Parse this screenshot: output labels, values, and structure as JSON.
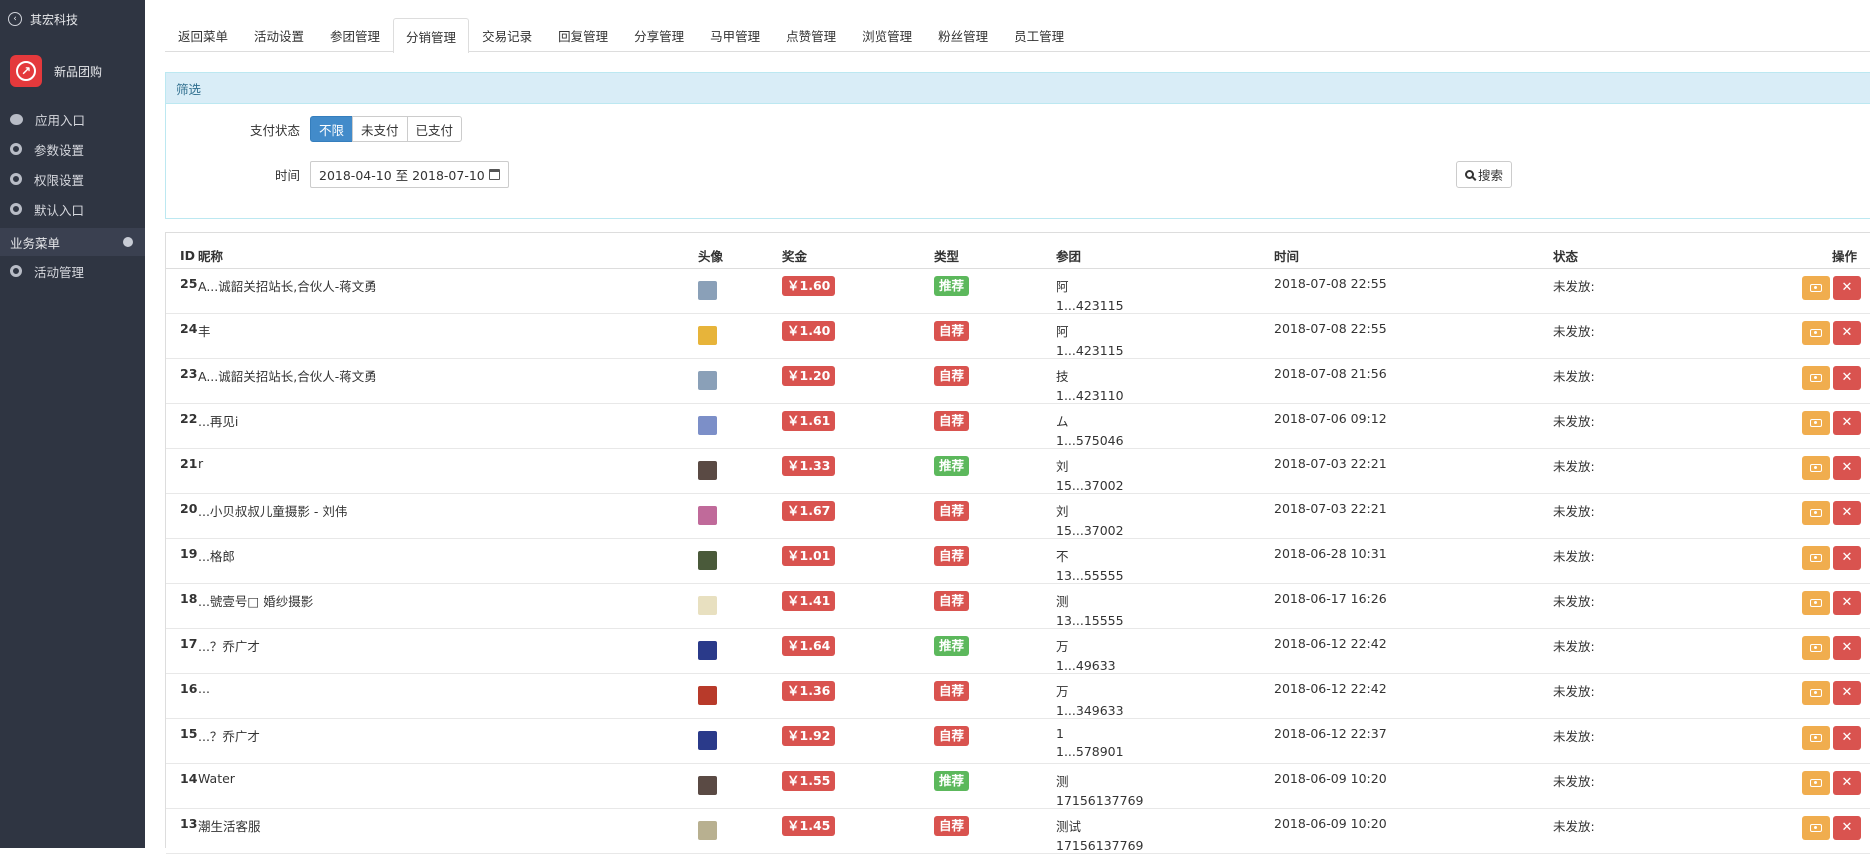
{
  "sidebar": {
    "back_label": "其宏科技",
    "brand_name": "新品团购",
    "items": [
      {
        "label": "应用入口",
        "icon": "comment-icon"
      },
      {
        "label": "参数设置",
        "icon": "gear-icon"
      },
      {
        "label": "权限设置",
        "icon": "gear-icon"
      },
      {
        "label": "默认入口",
        "icon": "gear-icon"
      }
    ],
    "section_label": "业务菜单",
    "section_items": [
      {
        "label": "活动管理",
        "icon": "gear-icon"
      }
    ]
  },
  "tabs": [
    "返回菜单",
    "活动设置",
    "参团管理",
    "分销管理",
    "交易记录",
    "回复管理",
    "分享管理",
    "马甲管理",
    "点赞管理",
    "浏览管理",
    "粉丝管理",
    "员工管理"
  ],
  "active_tab": "分销管理",
  "filter": {
    "title": "筛选",
    "pay_status_label": "支付状态",
    "pay_status_options": [
      "不限",
      "未支付",
      "已支付"
    ],
    "pay_status_selected": "不限",
    "time_label": "时间",
    "date_range": "2018-04-10 至 2018-07-10",
    "search_label": "搜索"
  },
  "table": {
    "headers": [
      "ID",
      "昵称",
      "头像",
      "奖金",
      "类型",
      "参团",
      "时间",
      "状态",
      "操作"
    ],
    "rows": [
      {
        "id": "25",
        "nickname": "A...诚韶关招站长,合伙人-蒋文勇",
        "avatar_color": "#8aa0b8",
        "bonus": "￥1.60",
        "type": "推荐",
        "join_name": "阿",
        "join_phone": "1...423115",
        "time": "2018-07-08 22:55",
        "status": "未发放:"
      },
      {
        "id": "24",
        "nickname": "丰",
        "avatar_color": "#e7b43a",
        "bonus": "￥1.40",
        "type": "自荐",
        "join_name": "阿",
        "join_phone": "1...423115",
        "time": "2018-07-08 22:55",
        "status": "未发放:"
      },
      {
        "id": "23",
        "nickname": "A...诚韶关招站长,合伙人-蒋文勇",
        "avatar_color": "#8aa0b8",
        "bonus": "￥1.20",
        "type": "自荐",
        "join_name": "技",
        "join_phone": "1...423110",
        "time": "2018-07-08 21:56",
        "status": "未发放:"
      },
      {
        "id": "22",
        "nickname": "...再见i",
        "avatar_color": "#7c8fc8",
        "bonus": "￥1.61",
        "type": "自荐",
        "join_name": "ム",
        "join_phone": "1...575046",
        "time": "2018-07-06 09:12",
        "status": "未发放:"
      },
      {
        "id": "21",
        "nickname": "r",
        "avatar_color": "#5a4a44",
        "bonus": "￥1.33",
        "type": "推荐",
        "join_name": "刘",
        "join_phone": "15...37002",
        "time": "2018-07-03 22:21",
        "status": "未发放:"
      },
      {
        "id": "20",
        "nickname": "...小贝叔叔儿童摄影 - 刘伟",
        "avatar_color": "#c06a9a",
        "bonus": "￥1.67",
        "type": "自荐",
        "join_name": "刘",
        "join_phone": "15...37002",
        "time": "2018-07-03 22:21",
        "status": "未发放:"
      },
      {
        "id": "19",
        "nickname": "...格郎",
        "avatar_color": "#4a5a3a",
        "bonus": "￥1.01",
        "type": "自荐",
        "join_name": "不",
        "join_phone": "13...55555",
        "time": "2018-06-28 10:31",
        "status": "未发放:"
      },
      {
        "id": "18",
        "nickname": "...號壹号□ 婚纱摄影",
        "avatar_color": "#e8e0c0",
        "bonus": "￥1.41",
        "type": "自荐",
        "join_name": "测",
        "join_phone": "13...15555",
        "time": "2018-06-17 16:26",
        "status": "未发放:"
      },
      {
        "id": "17",
        "nickname": "...？乔广才",
        "avatar_color": "#2a3a8a",
        "bonus": "￥1.64",
        "type": "推荐",
        "join_name": "万",
        "join_phone": "1...49633",
        "time": "2018-06-12 22:42",
        "status": "未发放:"
      },
      {
        "id": "16",
        "nickname": "...",
        "avatar_color": "#b83a2a",
        "bonus": "￥1.36",
        "type": "自荐",
        "join_name": "万",
        "join_phone": "1...349633",
        "time": "2018-06-12 22:42",
        "status": "未发放:"
      },
      {
        "id": "15",
        "nickname": "...？乔广才",
        "avatar_color": "#2a3a8a",
        "bonus": "￥1.92",
        "type": "自荐",
        "join_name": "1",
        "join_phone": "1...578901",
        "time": "2018-06-12 22:37",
        "status": "未发放:"
      },
      {
        "id": "14",
        "nickname": "Water",
        "avatar_color": "#5a4a44",
        "bonus": "￥1.55",
        "type": "推荐",
        "join_name": "测",
        "join_phone": "17156137769",
        "time": "2018-06-09 10:20",
        "status": "未发放:"
      },
      {
        "id": "13",
        "nickname": "潮生活客服",
        "avatar_color": "#b8b090",
        "bonus": "￥1.45",
        "type": "自荐",
        "join_name": "测试",
        "join_phone": "17156137769",
        "time": "2018-06-09 10:20",
        "status": "未发放:"
      }
    ]
  },
  "colors": {
    "sidebar_bg": "#2f3542",
    "primary": "#428bca",
    "danger": "#d9534f",
    "success": "#5cb85c",
    "warning": "#f0ad4e",
    "filter_head": "#d9edf7"
  }
}
